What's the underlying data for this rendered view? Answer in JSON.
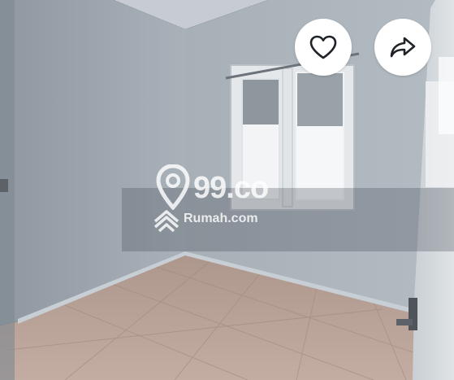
{
  "photo": {
    "description_icon": "room-photo",
    "colors": {
      "wall": "#a6aeb6",
      "floor": "#b39a8e",
      "window_frame": "#e6e9ec"
    }
  },
  "watermark": {
    "brand_primary": "99.co",
    "brand_secondary": "Rumah.com",
    "pin_icon": "map-pin-icon",
    "house_icon": "house-stack-icon"
  },
  "actions": {
    "like_icon": "heart-icon",
    "share_icon": "share-arrow-icon"
  }
}
